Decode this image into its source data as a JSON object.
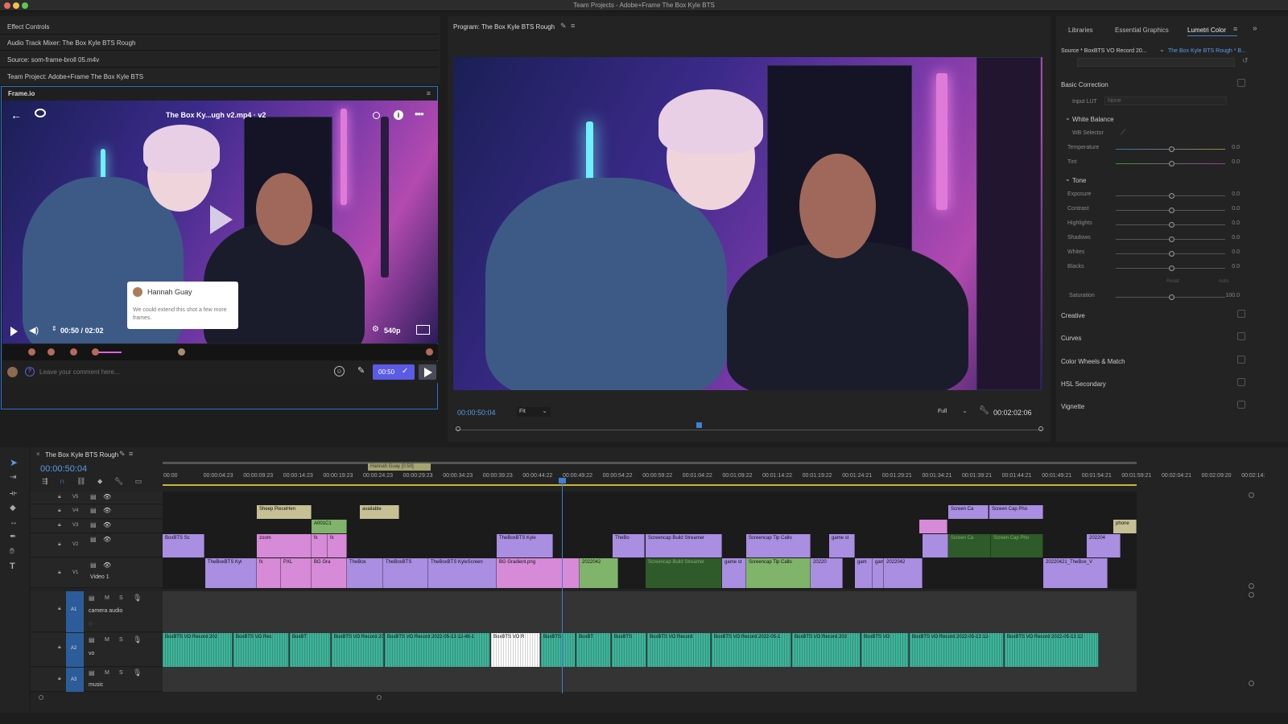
{
  "window": {
    "title": "Team Projects - Adobe+Frame The Box Kyle BTS"
  },
  "left_panel": {
    "tabs": [
      "Effect Controls",
      "Audio Track Mixer: The Box Kyle BTS Rough",
      "Source: som-frame-broll 05.m4v",
      "Team Project: Adobe+Frame The Box Kyle BTS"
    ]
  },
  "frameio": {
    "panel_title": "Frame.io",
    "file_title": "The Box Ky...ugh v2.mp4 · v2",
    "comment_author": "Hannah Guay",
    "comment_text": "We could extend this shot a few more frames.",
    "timecode": "00:50 / 02:02",
    "quality": "540p",
    "comment_placeholder": "Leave your comment here...",
    "comment_time": "00:50"
  },
  "program": {
    "title": "Program: The Box Kyle BTS Rough",
    "timecode": "00:00:50:04",
    "fit": "Fit",
    "full": "Full",
    "duration": "00:02:02:06",
    "playhead_fraction": 0.41
  },
  "right_panel": {
    "tabs": [
      "Libraries",
      "Essential Graphics",
      "Lumetri Color"
    ],
    "source_label": "Source * BoxBTS VO Record 20...",
    "sequence_label": "The Box Kyle BTS Rough * B...",
    "basic_correction": "Basic Correction",
    "input_lut_label": "Input LUT",
    "input_lut_value": "None",
    "white_balance": "White Balance",
    "wb_selector": "WB Selector",
    "wb_sliders": [
      {
        "label": "Temperature",
        "value": "0.0"
      },
      {
        "label": "Tint",
        "value": "0.0"
      }
    ],
    "tone": "Tone",
    "tone_sliders": [
      {
        "label": "Exposure",
        "value": "0.0"
      },
      {
        "label": "Contrast",
        "value": "0.0"
      },
      {
        "label": "Highlights",
        "value": "0.0"
      },
      {
        "label": "Shadows",
        "value": "0.0"
      },
      {
        "label": "Whites",
        "value": "0.0"
      },
      {
        "label": "Blacks",
        "value": "0.0"
      }
    ],
    "reset": "Reset",
    "auto": "Auto",
    "saturation_label": "Saturation",
    "saturation_value": "100.0",
    "sections": [
      "Creative",
      "Curves",
      "Color Wheels & Match",
      "HSL Secondary",
      "Vignette"
    ]
  },
  "timeline": {
    "sequence_name": "The Box Kyle BTS Rough",
    "timecode": "00:00:50:04",
    "ruler": [
      "00:00",
      "00:00:04:23",
      "00:00:09:23",
      "00:00:14:23",
      "00:00:19:23",
      "00:00:24:23",
      "00:00:29:23",
      "00:00:34:23",
      "00:00:39:23",
      "00:00:44:22",
      "00:00:49:22",
      "00:00:54:22",
      "00:00:59:22",
      "00:01:04:22",
      "00:01:09:22",
      "00:01:14:22",
      "00:01:19:22",
      "00:01:24:21",
      "00:01:29:21",
      "00:01:34:21",
      "00:01:39:21",
      "00:01:44:21",
      "00:01:49:21",
      "00:01:54:21",
      "00:01:59:21",
      "00:02:04:21",
      "00:02:09:20",
      "00:02:14:"
    ],
    "marker_label": "Hannah Guay [0:50]",
    "tracks": [
      {
        "id": "V5",
        "name": ""
      },
      {
        "id": "V4",
        "name": ""
      },
      {
        "id": "V3",
        "name": ""
      },
      {
        "id": "V2",
        "name": ""
      },
      {
        "id": "V1",
        "name": "Video 1"
      },
      {
        "id": "A1",
        "name": "camera audio"
      },
      {
        "id": "A2",
        "name": "vo"
      },
      {
        "id": "A3",
        "name": "music"
      }
    ],
    "v4_clips": [
      "Sheep PieceHen",
      "available",
      "Screen Ca",
      "Screen Cap Pho"
    ],
    "v3_clips": [
      "A001C1",
      "phone"
    ],
    "v2_clips": [
      "BoxBTS Sc",
      "zoom",
      "fx",
      "fx",
      "TheBoxBTS Kyle",
      "TheBo",
      "Screencap Build Streamer",
      "Screencap Tip Callo",
      "game st",
      "track",
      "Screen Ca",
      "Screen Cap Pho",
      "202204",
      "game strea"
    ],
    "v1_clips": [
      "TheBoxBTS Kyl",
      "fx",
      "PXL",
      "BG Gra",
      "TheBox",
      "TheBoxBTS",
      "TheBoxBTS KyleScreen",
      "BG Gradient.png",
      "2022042",
      "game stream",
      "Screencap Build Streamer",
      "game st",
      "Screencap Tip Callo",
      "20220",
      "game strea",
      "gam",
      "gam",
      "phone",
      "2022042",
      "20220421_TheBox_V",
      "game streamer game s"
    ],
    "a2_clips": [
      "BoxBTS VO Record 202",
      "BoxBTS VO Rec",
      "BoxBT",
      "BoxBTS VO Record 2022",
      "BoxBTS VO Record 2022-05-13 12-46-1",
      "BoxBTS VO R",
      "BoxBTS",
      "BoxBT",
      "BoxBTS",
      "BoxBTS VO Record",
      "BoxBTS VO Record 2022-05-1",
      "BoxBTS VO Record 202",
      "BoxBTS VO",
      "BoxBTS VO Record 2022-05-13 12-",
      "BoxBTS VO Record 2022-05-13 12"
    ]
  },
  "colors": {
    "accent": "#3f7fd8",
    "audio_clip": "#3fb39a",
    "video_clip": "#a98ee2",
    "pink_clip": "#d78ad7",
    "green_clip": "#7fb46a"
  }
}
